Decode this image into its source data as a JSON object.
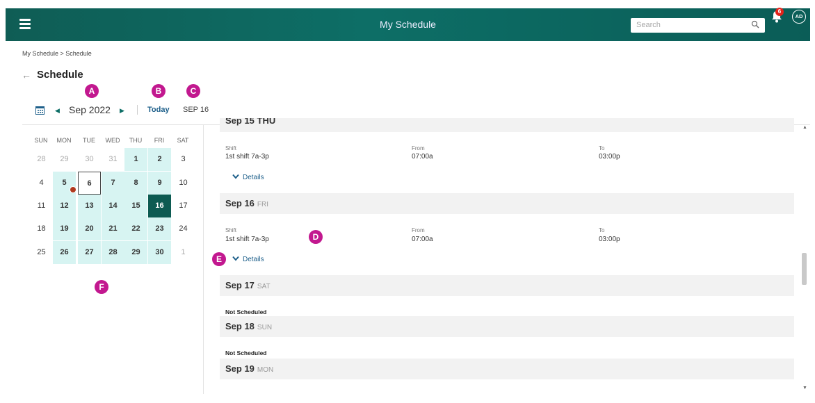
{
  "header": {
    "title": "My Schedule",
    "search_placeholder": "Search",
    "notification_count": "6",
    "avatar_initials": "AD"
  },
  "breadcrumb": "My Schedule > Schedule",
  "page_title": "Schedule",
  "markers": {
    "a": "A",
    "b": "B",
    "c": "C",
    "d": "D",
    "e": "E",
    "f": "F"
  },
  "nav": {
    "month": "Sep 2022",
    "today": "Today",
    "date": "SEP 16"
  },
  "calendar": {
    "weekdays": [
      "SUN",
      "MON",
      "TUE",
      "WED",
      "THU",
      "FRI",
      "SAT"
    ],
    "weeks": [
      [
        "28",
        "29",
        "30",
        "31",
        "1",
        "2",
        "3"
      ],
      [
        "4",
        "5",
        "6",
        "7",
        "8",
        "9",
        "10"
      ],
      [
        "11",
        "12",
        "13",
        "14",
        "15",
        "16",
        "17"
      ],
      [
        "18",
        "19",
        "20",
        "21",
        "22",
        "23",
        "24"
      ],
      [
        "25",
        "26",
        "27",
        "28",
        "29",
        "30",
        "1"
      ]
    ],
    "scheduled_days": [
      "1",
      "2",
      "5",
      "6",
      "7",
      "8",
      "9",
      "12",
      "13",
      "14",
      "15",
      "16",
      "19",
      "20",
      "21",
      "22",
      "23",
      "26",
      "27",
      "28",
      "29",
      "30"
    ],
    "selected_day": "16",
    "outlined_day": "6",
    "event_day": "5"
  },
  "schedule": {
    "top_day_partial": "Sep 15 THU",
    "shift_label": "Shift",
    "from_label": "From",
    "to_label": "To",
    "details_label": "Details",
    "not_scheduled_label": "Not Scheduled",
    "entries": [
      {
        "shift": "1st shift 7a-3p",
        "from": "07:00a",
        "to": "03:00p"
      },
      {
        "shift": "1st shift 7a-3p",
        "from": "07:00a",
        "to": "03:00p"
      }
    ],
    "days": [
      {
        "date": "Sep 16",
        "weekday": "FRI"
      },
      {
        "date": "Sep 17",
        "weekday": "SAT"
      },
      {
        "date": "Sep 18",
        "weekday": "SUN"
      },
      {
        "date": "Sep 19",
        "weekday": "MON"
      }
    ]
  },
  "colors": {
    "header": "#0d6e66",
    "selected": "#0d5b52",
    "scheduled": "#d7f4f2",
    "marker": "#c2188f",
    "link": "#1d5f8a"
  },
  "icons": [
    "hamburger-icon",
    "search-icon",
    "bell-icon",
    "calendar-icon",
    "chevron-left-icon",
    "chevron-right-icon",
    "back-arrow-icon",
    "chevron-down-icon"
  ]
}
